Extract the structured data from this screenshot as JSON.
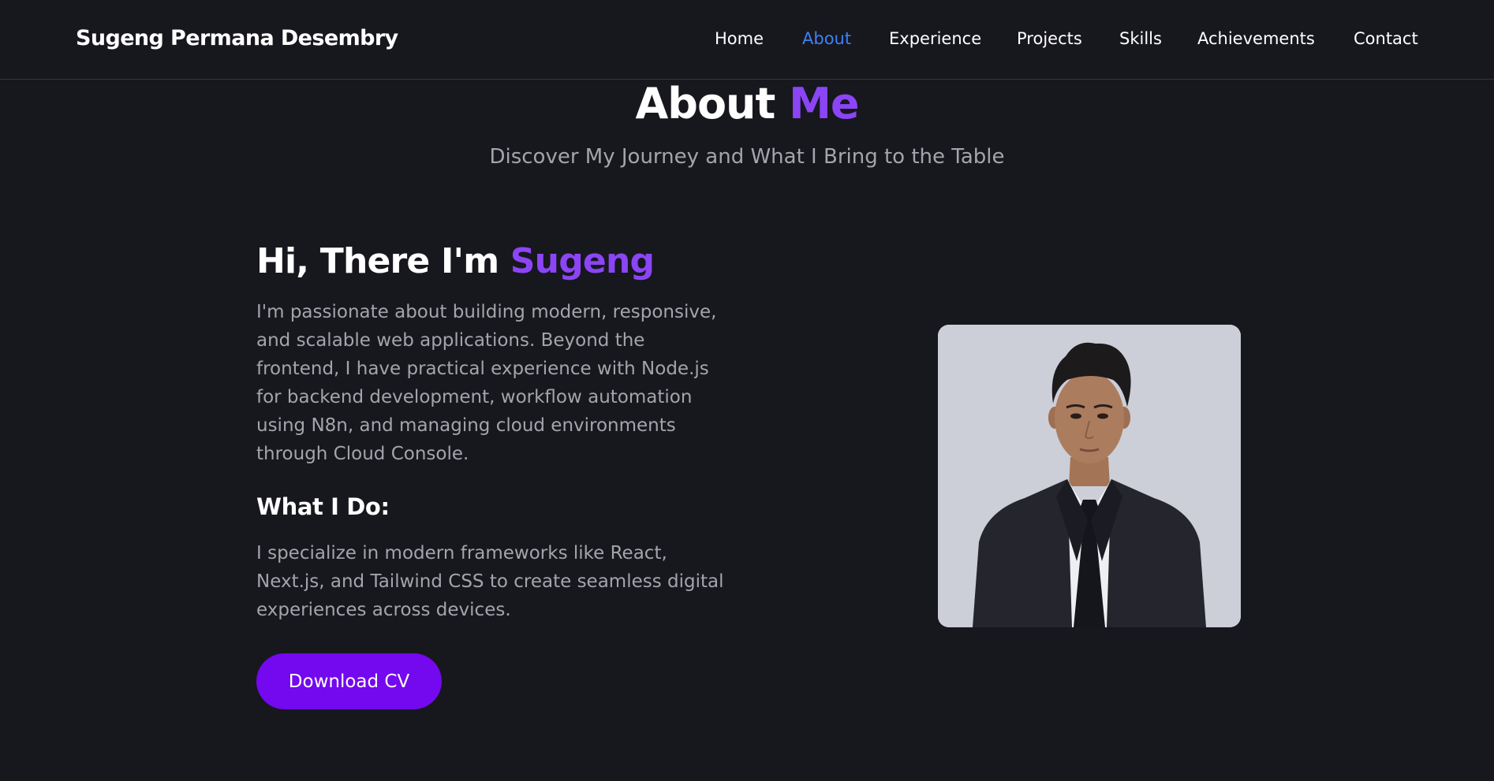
{
  "nav": {
    "brand": "Sugeng Permana Desembry",
    "items": [
      {
        "label": "Home",
        "active": false
      },
      {
        "label": "About",
        "active": true
      },
      {
        "label": "Experience",
        "active": false
      },
      {
        "label": "Projects",
        "active": false
      },
      {
        "label": "Skills",
        "active": false
      },
      {
        "label": "Achievements",
        "active": false
      },
      {
        "label": "Contact",
        "active": false
      }
    ]
  },
  "about": {
    "title_main": "About ",
    "title_accent": "Me",
    "subtitle": "Discover My Journey and What I Bring to the Table",
    "greeting_main": "Hi, There I'm ",
    "greeting_accent": "Sugeng",
    "intro": "I'm passionate about building modern, responsive, and scalable web applications. Beyond the frontend, I have practical experience with Node.js for backend development, workflow automation using N8n, and managing cloud environments through Cloud Console.",
    "what_heading": "What I Do:",
    "what_text": "I specialize in modern frameworks like React, Next.js, and Tailwind CSS to create seamless digital experiences across devices.",
    "cv_button": "Download CV"
  },
  "colors": {
    "background": "#17171e",
    "accent": "#8b45f5",
    "nav_active": "#3b82f6",
    "button": "#7408ee",
    "muted_text": "#a4a4ab"
  }
}
